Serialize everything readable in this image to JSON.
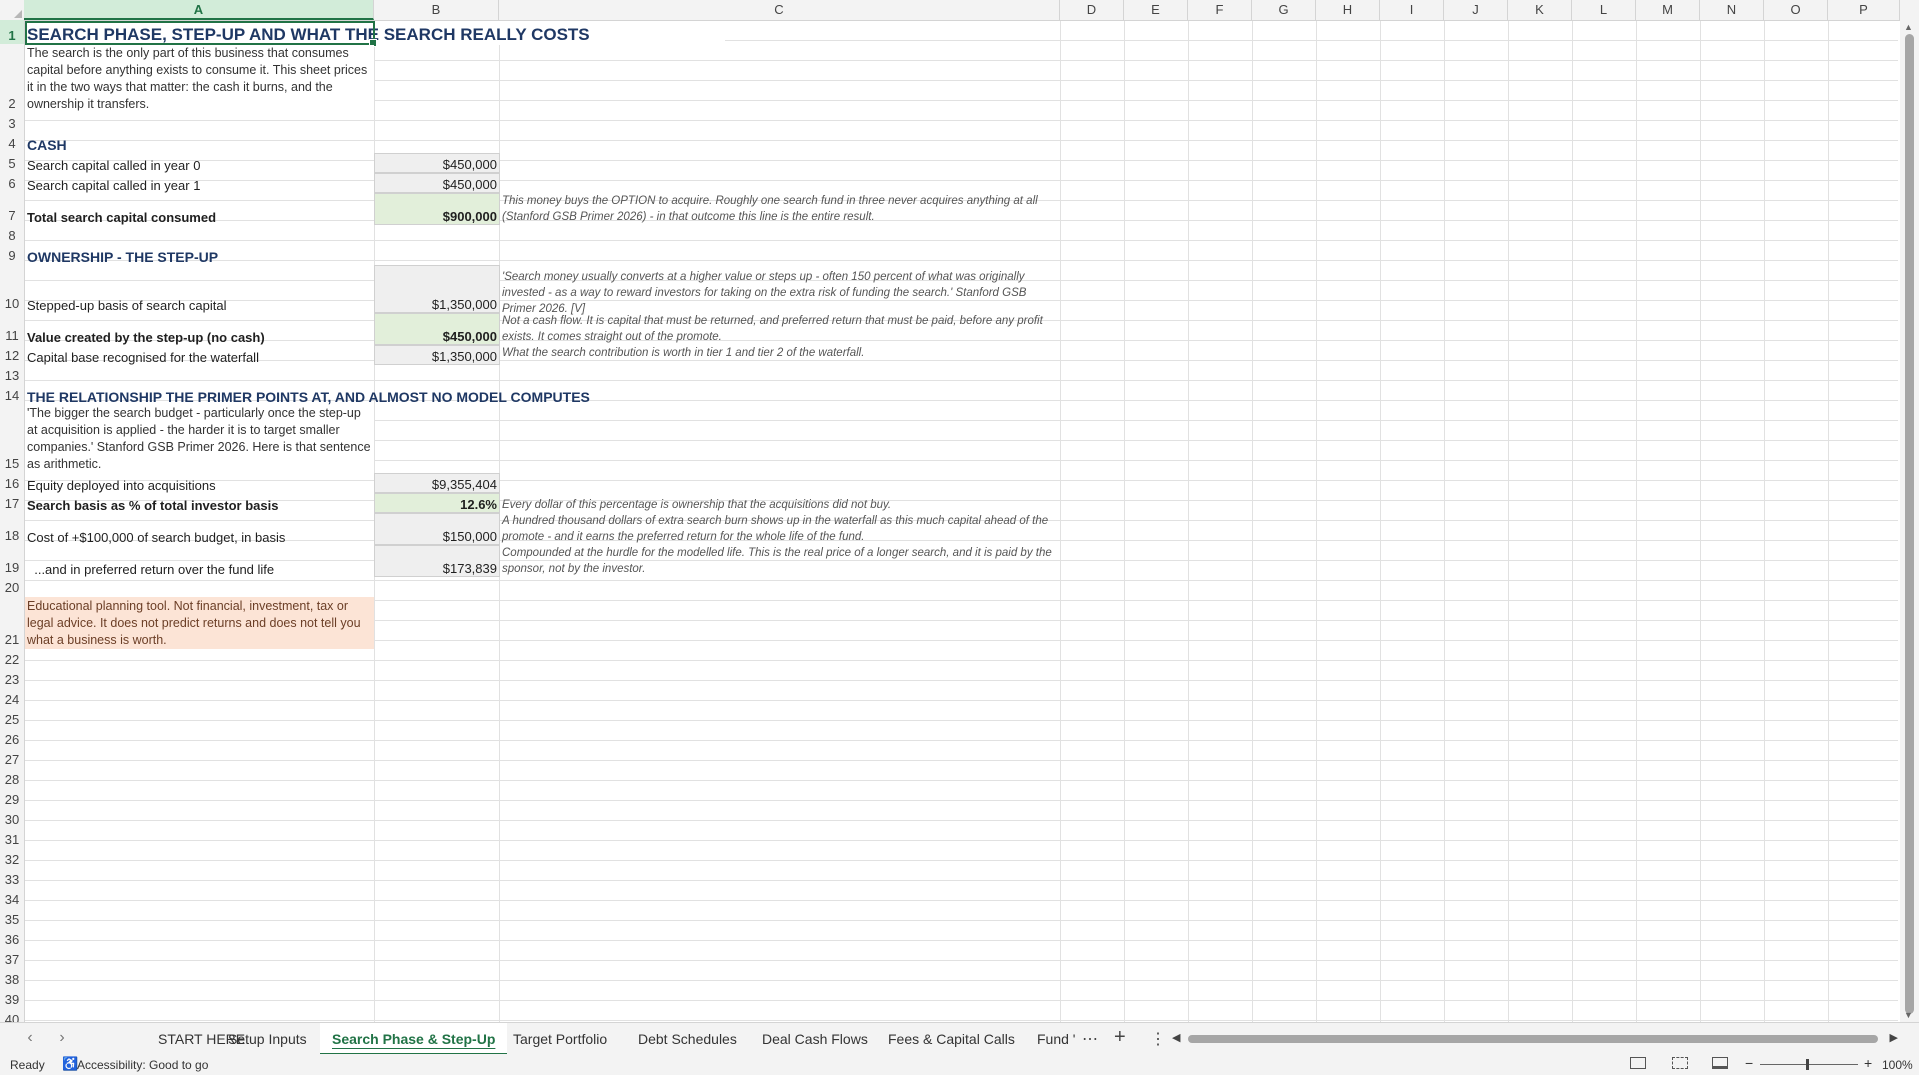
{
  "columns": [
    "A",
    "B",
    "C",
    "D",
    "E",
    "F",
    "G",
    "H",
    "I",
    "J",
    "K",
    "L",
    "M",
    "N",
    "O",
    "P"
  ],
  "rows": [
    "1",
    "2",
    "3",
    "4",
    "5",
    "6",
    "7",
    "8",
    "9",
    "10",
    "11",
    "12",
    "13",
    "14",
    "15",
    "16",
    "17",
    "18",
    "19",
    "20",
    "21",
    "22",
    "23",
    "24",
    "25",
    "26",
    "27",
    "28",
    "29",
    "30",
    "31",
    "32",
    "33",
    "34",
    "35",
    "36",
    "37",
    "38",
    "39",
    "40"
  ],
  "sheet": {
    "title": "SEARCH PHASE, STEP-UP AND WHAT THE SEARCH REALLY COSTS",
    "intro": "The search is the only part of this business that consumes capital before anything exists to consume it. This sheet prices it in the two ways that matter: the cash it burns, and the ownership it transfers.",
    "cash_header": "CASH",
    "r5_label": "Search capital called in year 0",
    "r5_value": "$450,000",
    "r6_label": "Search capital called in year 1",
    "r6_value": "$450,000",
    "r7_label": "Total search capital consumed",
    "r7_value": "$900,000",
    "r7_note": "This money buys the OPTION to acquire. Roughly one search fund in three never acquires anything at all (Stanford GSB Primer 2026) - in that outcome this line is the entire result.",
    "own_header": "OWNERSHIP - THE STEP-UP",
    "r10_label": "Stepped-up basis of search capital",
    "r10_value": "$1,350,000",
    "r10_note": "'Search money usually converts at a higher value or steps up - often 150 percent of what was originally invested - as a way to reward investors for taking on the extra risk of funding the search.' Stanford GSB Primer 2026. [V]",
    "r11_label": "Value created by the step-up (no cash)",
    "r11_value": "$450,000",
    "r11_note": "Not a cash flow. It is capital that must be returned, and preferred return that must be paid, before any profit exists. It comes straight out of the promote.",
    "r12_label": "Capital base recognised for the waterfall",
    "r12_value": "$1,350,000",
    "r12_note": "What the search contribution is worth in tier 1 and tier 2 of the waterfall.",
    "rel_header": "THE RELATIONSHIP THE PRIMER POINTS AT, AND ALMOST NO MODEL COMPUTES",
    "r15_text": "'The bigger the search budget - particularly once the step-up at acquisition is applied - the harder it is to target smaller companies.' Stanford GSB Primer 2026. Here is that sentence as arithmetic.",
    "r16_label": "Equity deployed into acquisitions",
    "r16_value": "$9,355,404",
    "r17_label": "Search basis as % of total investor basis",
    "r17_value": "12.6%",
    "r17_note": "Every dollar of this percentage is ownership that the acquisitions did not buy.",
    "r18_label": "Cost of +$100,000 of search budget, in basis",
    "r18_value": "$150,000",
    "r18_note": "A hundred thousand dollars of extra search burn shows up in the waterfall as this much capital ahead of the promote - and it earns the preferred return for the whole life of the fund.",
    "r19_label": "  ...and in preferred return over the fund life",
    "r19_value": "$173,839",
    "r19_note": "Compounded at the hurdle for the modelled life. This is the real price of a longer search, and it is paid by the sponsor, not by the investor.",
    "disclaimer": "Educational planning tool. Not financial, investment, tax or legal advice. It does not predict returns and does not tell you what a business is worth."
  },
  "tabs": [
    "START HERE",
    "Setup Inputs",
    "Search Phase & Step-Up",
    "Target Portfolio",
    "Debt Schedules",
    "Deal Cash Flows",
    "Fees & Capital Calls",
    "Fund '"
  ],
  "active_tab": "Search Phase & Step-Up",
  "status": {
    "ready": "Ready",
    "accessibility": "Accessibility: Good to go",
    "zoom": "100%"
  },
  "colors": {
    "accent": "#217346",
    "heading": "#1f3864",
    "input_fill": "#efefef",
    "result_fill": "#e2efda",
    "disclaimer_fill": "#fce4d6"
  }
}
